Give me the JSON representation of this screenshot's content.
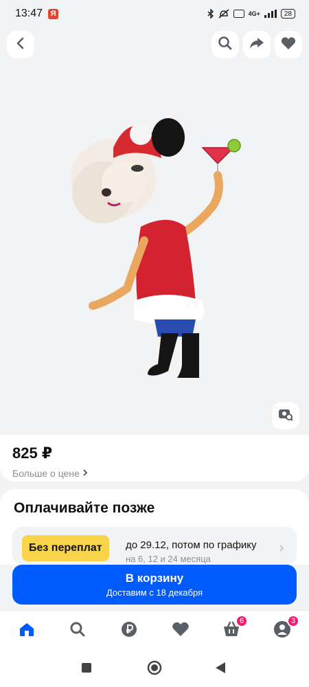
{
  "status": {
    "time": "13:47",
    "app_badge": "Я",
    "network": "4G+",
    "battery": "28"
  },
  "product": {
    "price": "825 ₽",
    "price_more": "Больше о цене"
  },
  "payment": {
    "title": "Оплачивайте позже",
    "tag": "Без переплат",
    "line1": "до 29.12, потом по графику",
    "line2": "на 6, 12 и 24 месяца"
  },
  "cart": {
    "label": "В корзину",
    "delivery": "Доставим с 18 декабря"
  },
  "tabs": {
    "cart_count": "6",
    "profile_count": "3"
  },
  "colors": {
    "accent": "#005bff",
    "badge": "#f51b75",
    "tag": "#f7d44a"
  }
}
